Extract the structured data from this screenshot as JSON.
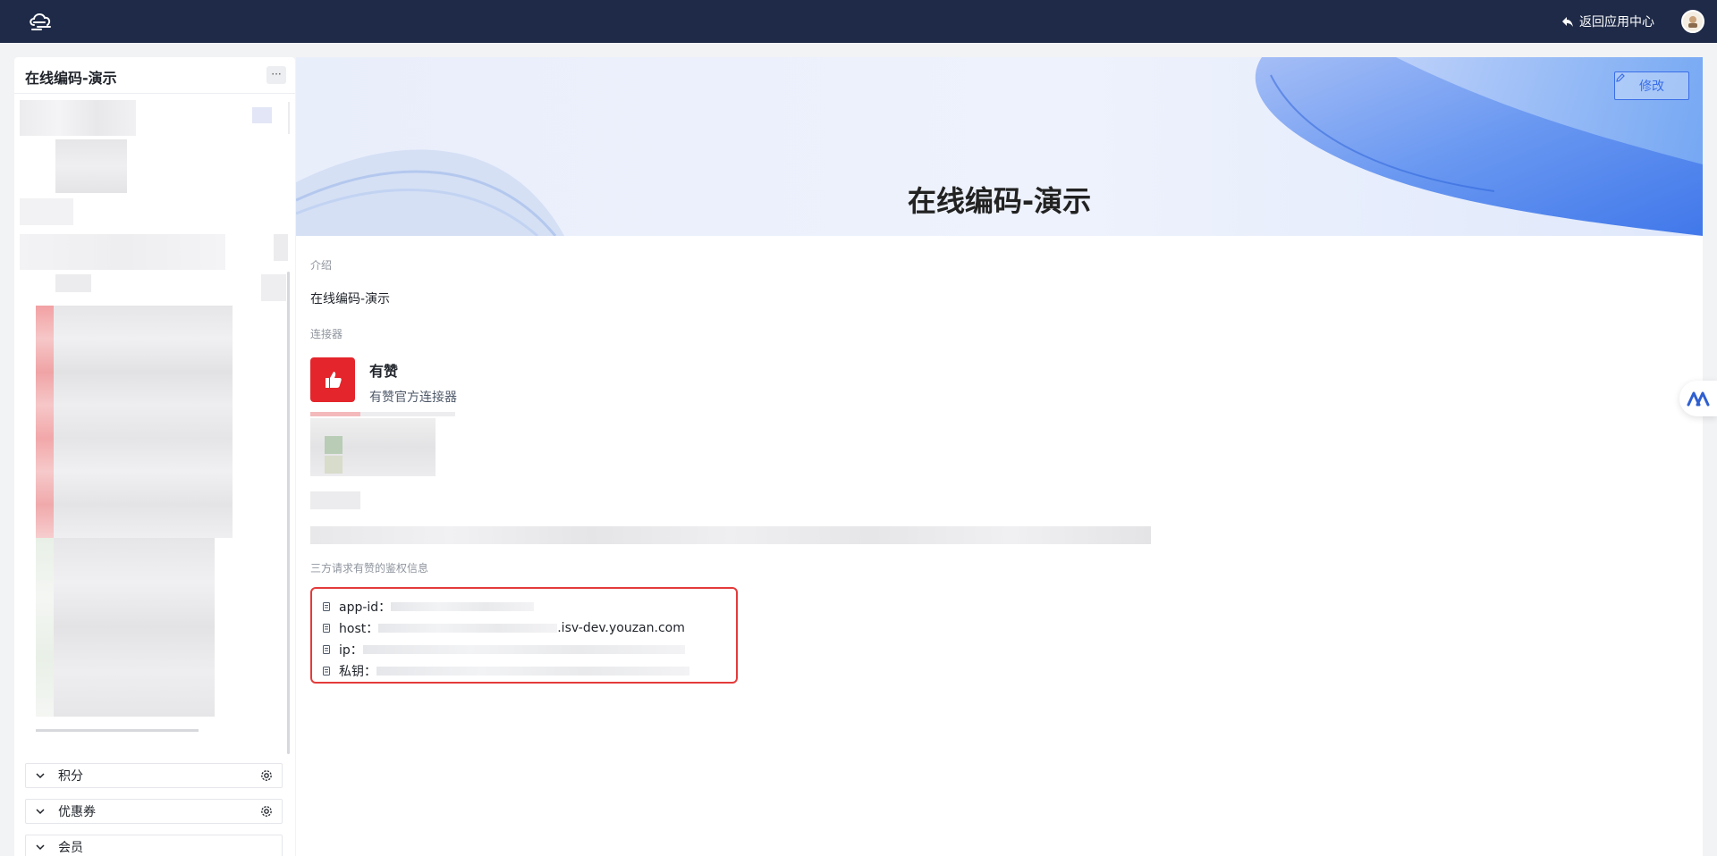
{
  "header": {
    "back_label": "返回应用中心"
  },
  "sidebar": {
    "title": "在线编码-演示",
    "more_label": "···",
    "sections": [
      {
        "label": "积分"
      },
      {
        "label": "优惠券"
      },
      {
        "label": "会员"
      }
    ]
  },
  "main": {
    "banner_title": "在线编码-演示",
    "edit_label": "修改",
    "intro_label": "介绍",
    "intro_text": "在线编码-演示",
    "connector_label": "连接器",
    "connector": {
      "name": "有赞",
      "description": "有赞官方连接器"
    },
    "auth_label": "三方请求有赞的鉴权信息",
    "auth": {
      "app_id_label": "app-id：",
      "host_label": "host：",
      "host_suffix": ".isv-dev.youzan.com",
      "ip_label": "ip：",
      "key_label": "私钥："
    }
  },
  "colors": {
    "topbar": "#1e2a47",
    "accent": "#3a6ee8",
    "danger": "#e43b3b",
    "brand_red": "#e4252b"
  }
}
